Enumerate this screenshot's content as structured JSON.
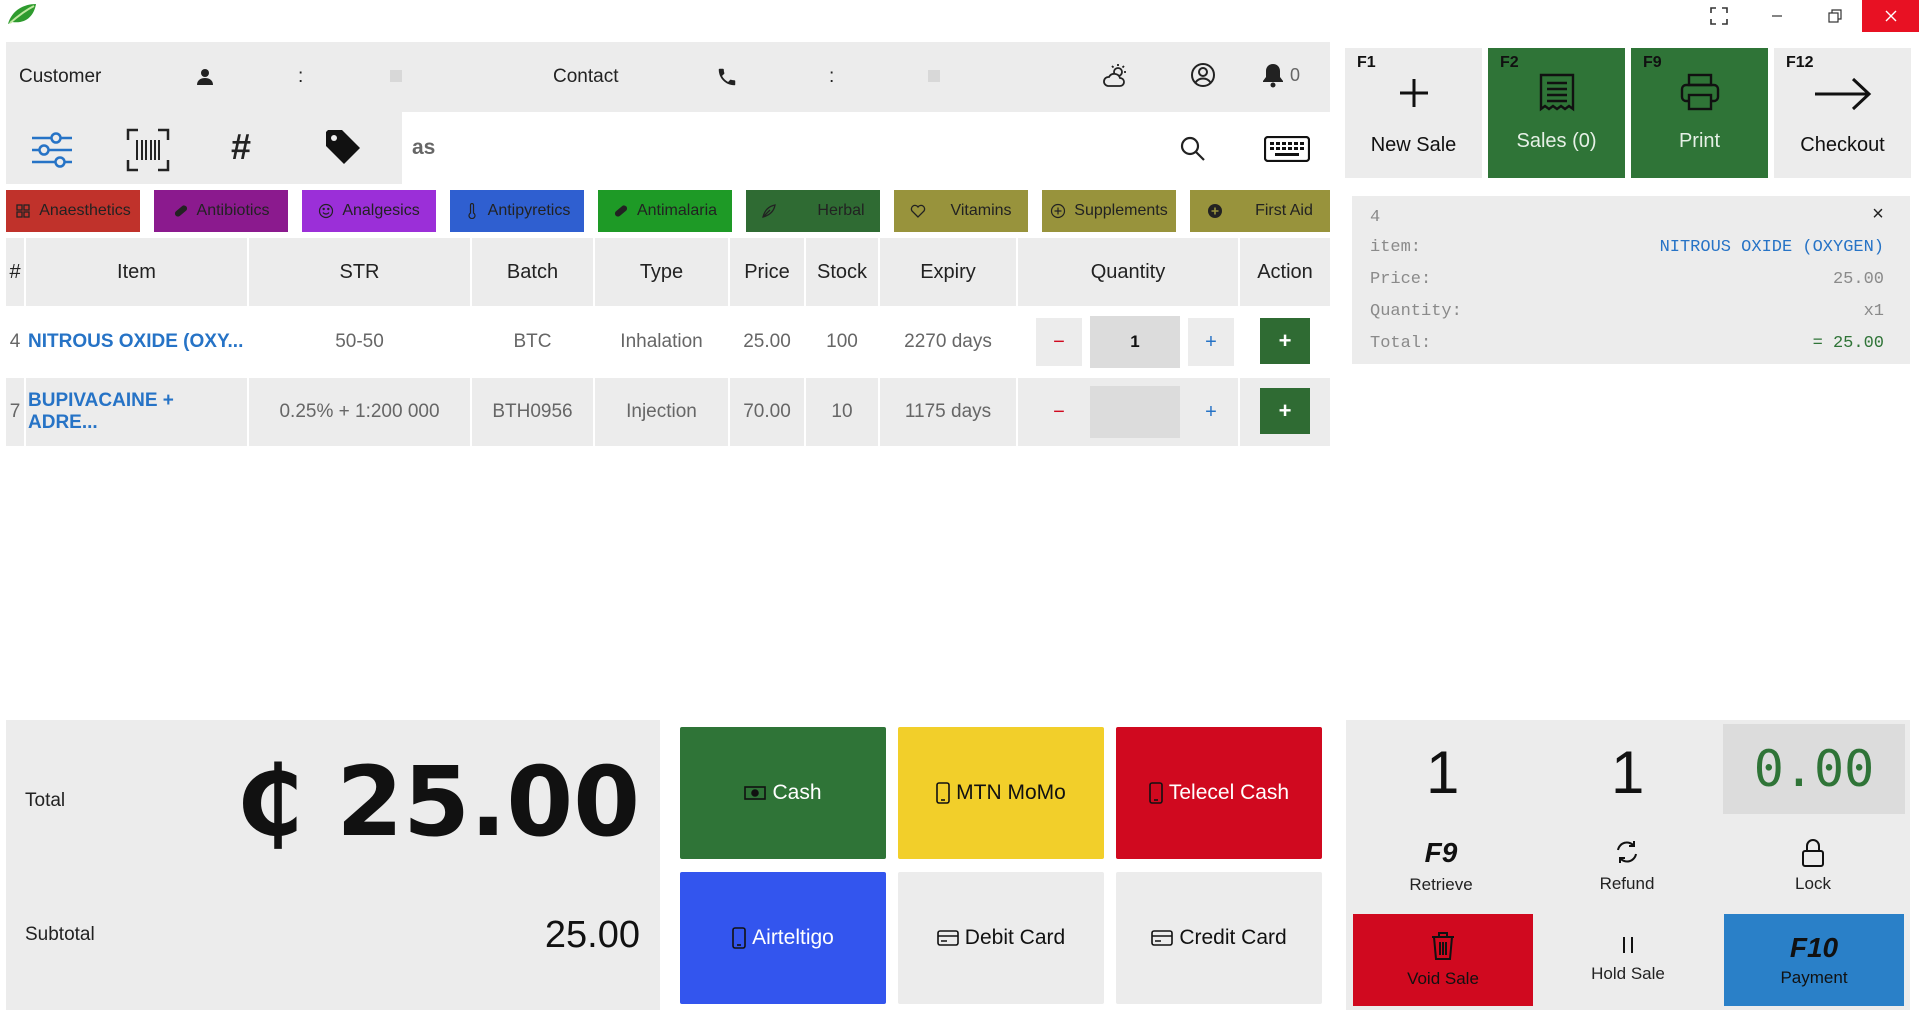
{
  "titlebar": {
    "icons": [
      "leaf-logo-icon",
      "fullscreen-icon",
      "minimize-icon",
      "restore-icon",
      "close-icon"
    ]
  },
  "header": {
    "customer_label": "Customer",
    "customer_sep": ":",
    "contact_label": "Contact",
    "contact_sep": ":",
    "notification_count": "0"
  },
  "search": {
    "value": "as"
  },
  "categories": [
    {
      "label": "Anaesthetics",
      "color": "#c0322b"
    },
    {
      "label": "Antibiotics",
      "color": "#8b1a8e"
    },
    {
      "label": "Analgesics",
      "color": "#9b2fd8"
    },
    {
      "label": "Antipyretics",
      "color": "#2f5fd0"
    },
    {
      "label": "Antimalaria",
      "color": "#1e9a26"
    },
    {
      "label": "Herbal",
      "color": "#2f6b33"
    },
    {
      "label": "Vitamins",
      "color": "#98933c"
    },
    {
      "label": "Supplements",
      "color": "#98933c"
    },
    {
      "label": "First Aid",
      "color": "#98933c"
    }
  ],
  "table": {
    "headers": [
      "#",
      "Item",
      "STR",
      "Batch",
      "Type",
      "Price",
      "Stock",
      "Expiry",
      "Quantity",
      "Action"
    ],
    "rows": [
      {
        "id": "4",
        "item": "NITROUS OXIDE (OXY...",
        "str": "50-50",
        "batch": "BTC",
        "type": "Inhalation",
        "price": "25.00",
        "stock": "100",
        "expiry": "2270 days",
        "qty": "1",
        "minus": "−",
        "plus": "+",
        "action": "+"
      },
      {
        "id": "7",
        "item": "BUPIVACAINE + ADRE...",
        "str": "0.25% + 1:200 000",
        "batch": "BTH0956",
        "type": "Injection",
        "price": "70.00",
        "stock": "10",
        "expiry": "1175 days",
        "qty": "",
        "minus": "−",
        "plus": "+",
        "action": "+"
      }
    ]
  },
  "fkeys": [
    {
      "key": "F1",
      "label": "New Sale"
    },
    {
      "key": "F2",
      "label": "Sales (0)"
    },
    {
      "key": "F9",
      "label": "Print"
    },
    {
      "key": "F12",
      "label": "Checkout"
    }
  ],
  "detail": {
    "id": "4",
    "close": "×",
    "item_label": "item:",
    "item_value": "NITROUS OXIDE (OXYGEN)",
    "price_label": "Price:",
    "price_value": "25.00",
    "qty_label": "Quantity:",
    "qty_value": "x1",
    "total_label": "Total:",
    "total_value": "= 25.00"
  },
  "totals": {
    "total_label": "Total",
    "total_value": "₵ 25.00",
    "subtotal_label": "Subtotal",
    "subtotal_value": "25.00"
  },
  "payments": [
    {
      "label": "Cash",
      "color": "#2f7437"
    },
    {
      "label": "MTN MoMo",
      "color": "#f2cf2a"
    },
    {
      "label": "Telecel Cash",
      "color": "#d0091f"
    },
    {
      "label": "Airteltigo",
      "color": "#3355ee"
    },
    {
      "label": "Debit Card",
      "color": "#ececec"
    },
    {
      "label": "Credit Card",
      "color": "#ececec"
    }
  ],
  "rpanel": {
    "count1": "1",
    "count2": "1",
    "amount": "0.00",
    "retrieve_key": "F9",
    "retrieve_label": "Retrieve",
    "refund_label": "Refund",
    "lock_label": "Lock",
    "void_label": "Void Sale",
    "hold_label": "Hold Sale",
    "payment_key": "F10",
    "payment_label": "Payment"
  }
}
